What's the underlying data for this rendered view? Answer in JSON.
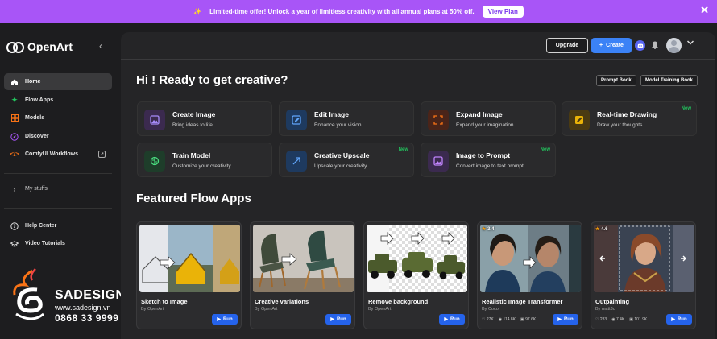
{
  "banner": {
    "message": "Limited-time offer! Unlock a year of limitless creativity with all annual plans at 50% off.",
    "cta": "View Plan"
  },
  "sidebar": {
    "brand": "OpenArt",
    "items": [
      {
        "label": "Home",
        "icon": "home-icon"
      },
      {
        "label": "Flow Apps",
        "icon": "flow-apps-icon"
      },
      {
        "label": "Models",
        "icon": "models-icon"
      },
      {
        "label": "Discover",
        "icon": "compass-icon"
      },
      {
        "label": "ComfyUI Workflows",
        "icon": "code-icon"
      }
    ],
    "my_stuffs": "My stuffs",
    "help": [
      {
        "label": "Help Center",
        "icon": "help-icon"
      },
      {
        "label": "Video Tutorials",
        "icon": "graduation-cap-icon"
      }
    ]
  },
  "watermark": {
    "brand": "SADESIGN",
    "site": "www.sadesign.vn",
    "phone": "0868 33 9999"
  },
  "topbar": {
    "upgrade": "Upgrade",
    "create": "Create"
  },
  "main": {
    "greeting": "Hi ! Ready to get creative?",
    "prompt_book": "Prompt Book",
    "model_training_book": "Model Training Book",
    "tools": [
      {
        "title": "Create Image",
        "subtitle": "Bring ideas to life",
        "badge": "",
        "color": "#3b2a4f",
        "icon_color": "#a78bfa"
      },
      {
        "title": "Edit Image",
        "subtitle": "Enhance your vision",
        "badge": "",
        "color": "#1e3a5f",
        "icon_color": "#60a5fa"
      },
      {
        "title": "Expand Image",
        "subtitle": "Expand your imagination",
        "badge": "",
        "color": "#4a2419",
        "icon_color": "#f97316"
      },
      {
        "title": "Real-time Drawing",
        "subtitle": "Draw your thoughts",
        "badge": "New",
        "color": "#4a3a12",
        "icon_color": "#eab308"
      },
      {
        "title": "Train Model",
        "subtitle": "Customize your creativity",
        "badge": "",
        "color": "#1e3d2a",
        "icon_color": "#4ade80"
      },
      {
        "title": "Creative Upscale",
        "subtitle": "Upscale your creativity",
        "badge": "New",
        "color": "#1e3a5f",
        "icon_color": "#60a5fa"
      },
      {
        "title": "Image to Prompt",
        "subtitle": "Convert image to text prompt",
        "badge": "New",
        "color": "#3b2a4f",
        "icon_color": "#c084fc"
      }
    ],
    "featured_title": "Featured Flow Apps",
    "run_label": "Run",
    "apps": [
      {
        "title": "Sketch to Image",
        "by": "By OpenArt",
        "rating": "",
        "stats": []
      },
      {
        "title": "Creative variations",
        "by": "By OpenArt",
        "rating": "",
        "stats": []
      },
      {
        "title": "Remove background",
        "by": "By OpenArt",
        "rating": "",
        "stats": []
      },
      {
        "title": "Realistic Image Transformer",
        "by": "By Coco",
        "rating": "3.4",
        "stats": [
          "27K",
          "114.8K",
          "97.6K"
        ]
      },
      {
        "title": "Outpainting",
        "by": "By matt3o",
        "rating": "4.6",
        "stats": [
          "233",
          "7.4K",
          "101.9K"
        ]
      }
    ]
  }
}
